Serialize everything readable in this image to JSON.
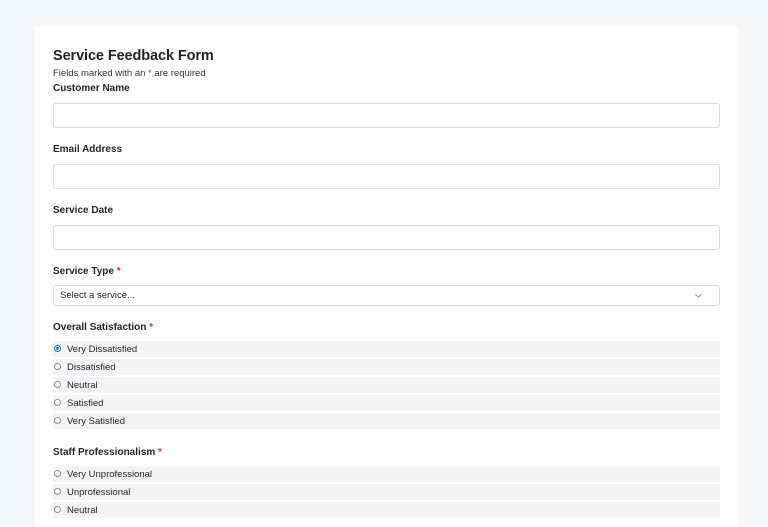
{
  "form": {
    "title": "Service Feedback Form",
    "required_note_prefix": "Fields marked with an ",
    "required_star": "*",
    "required_note_suffix": " are required"
  },
  "fields": {
    "customer_name": {
      "label": "Customer Name",
      "value": "",
      "placeholder": ""
    },
    "email": {
      "label": "Email Address",
      "value": "",
      "placeholder": ""
    },
    "service_date": {
      "label": "Service Date",
      "value": "",
      "placeholder": ""
    },
    "service_type": {
      "label": "Service Type",
      "required_star": "*",
      "selected": "Select a service..."
    },
    "overall_satisfaction": {
      "label": "Overall Satisfaction",
      "required_star": "*",
      "options": [
        "Very Dissatisfied",
        "Dissatisfied",
        "Neutral",
        "Satisfied",
        "Very Satisfied"
      ],
      "selected": "Very Dissatisfied"
    },
    "staff_professionalism": {
      "label": "Staff Professionalism",
      "required_star": "*",
      "options": [
        "Very Unprofessional",
        "Unprofessional",
        "Neutral"
      ],
      "selected": ""
    }
  },
  "colors": {
    "page_bg": "#f6f7f9",
    "card_bg": "#ffffff",
    "required": "#d12d2d",
    "radio_accent": "#2b6fe3",
    "option_row_bg": "#f3f4f6"
  },
  "icons": {
    "select_arrow": "chevron-down-icon"
  }
}
